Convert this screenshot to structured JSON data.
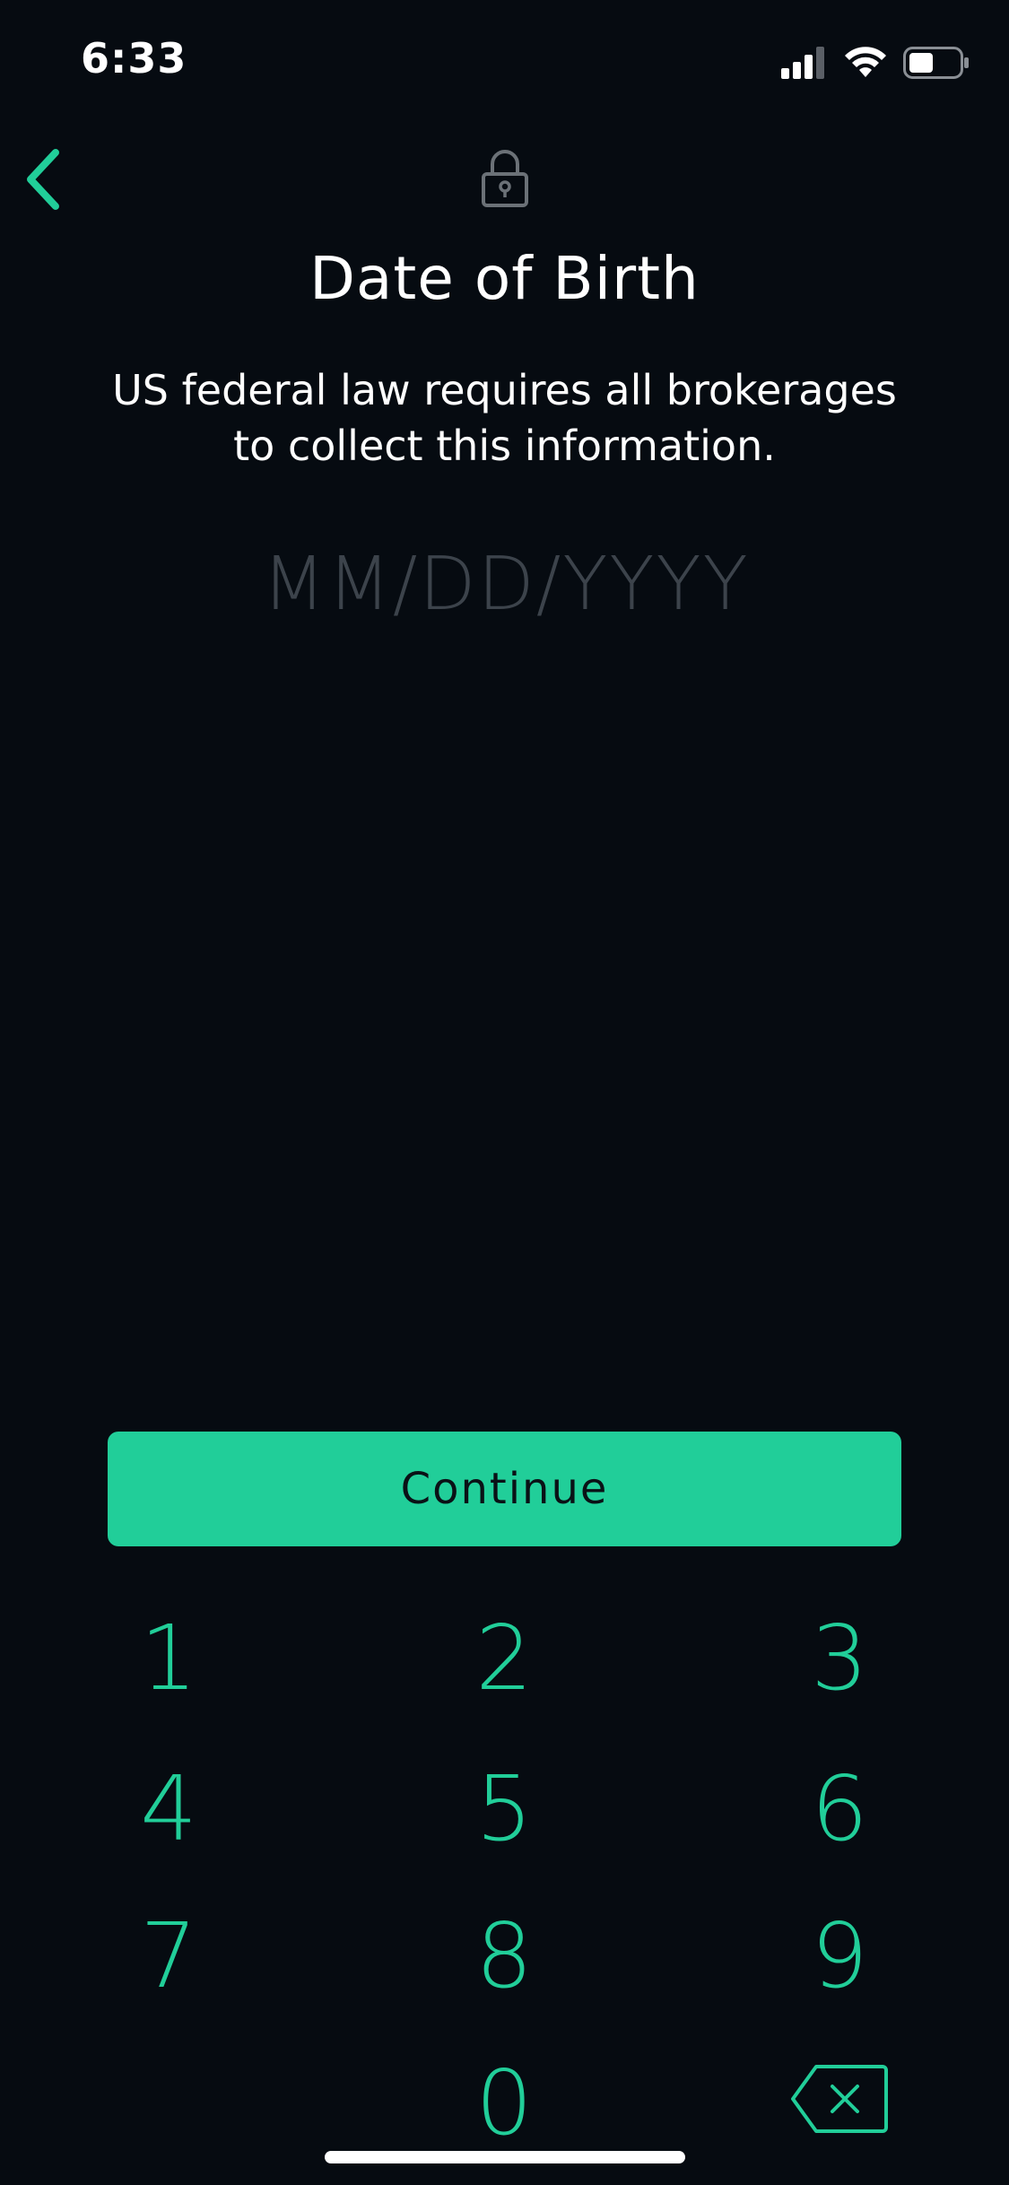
{
  "status_bar": {
    "time": "6:33",
    "signal_icon": "cellular-signal-icon",
    "wifi_icon": "wifi-icon",
    "battery_icon": "battery-icon"
  },
  "header": {
    "back_icon": "chevron-left-icon",
    "lock_icon": "lock-icon"
  },
  "main": {
    "title": "Date of Birth",
    "subtitle": "US federal law requires all brokerages to collect this information.",
    "dob_value": "",
    "dob_placeholder": "MM/DD/YYYY"
  },
  "continue_label": "Continue",
  "keypad": {
    "keys": [
      "1",
      "2",
      "3",
      "4",
      "5",
      "6",
      "7",
      "8",
      "9",
      "0"
    ],
    "backspace_icon": "backspace-icon"
  },
  "colors": {
    "background": "#060b11",
    "accent": "#21ce99",
    "text": "#ffffff",
    "placeholder": "#3c434b"
  }
}
